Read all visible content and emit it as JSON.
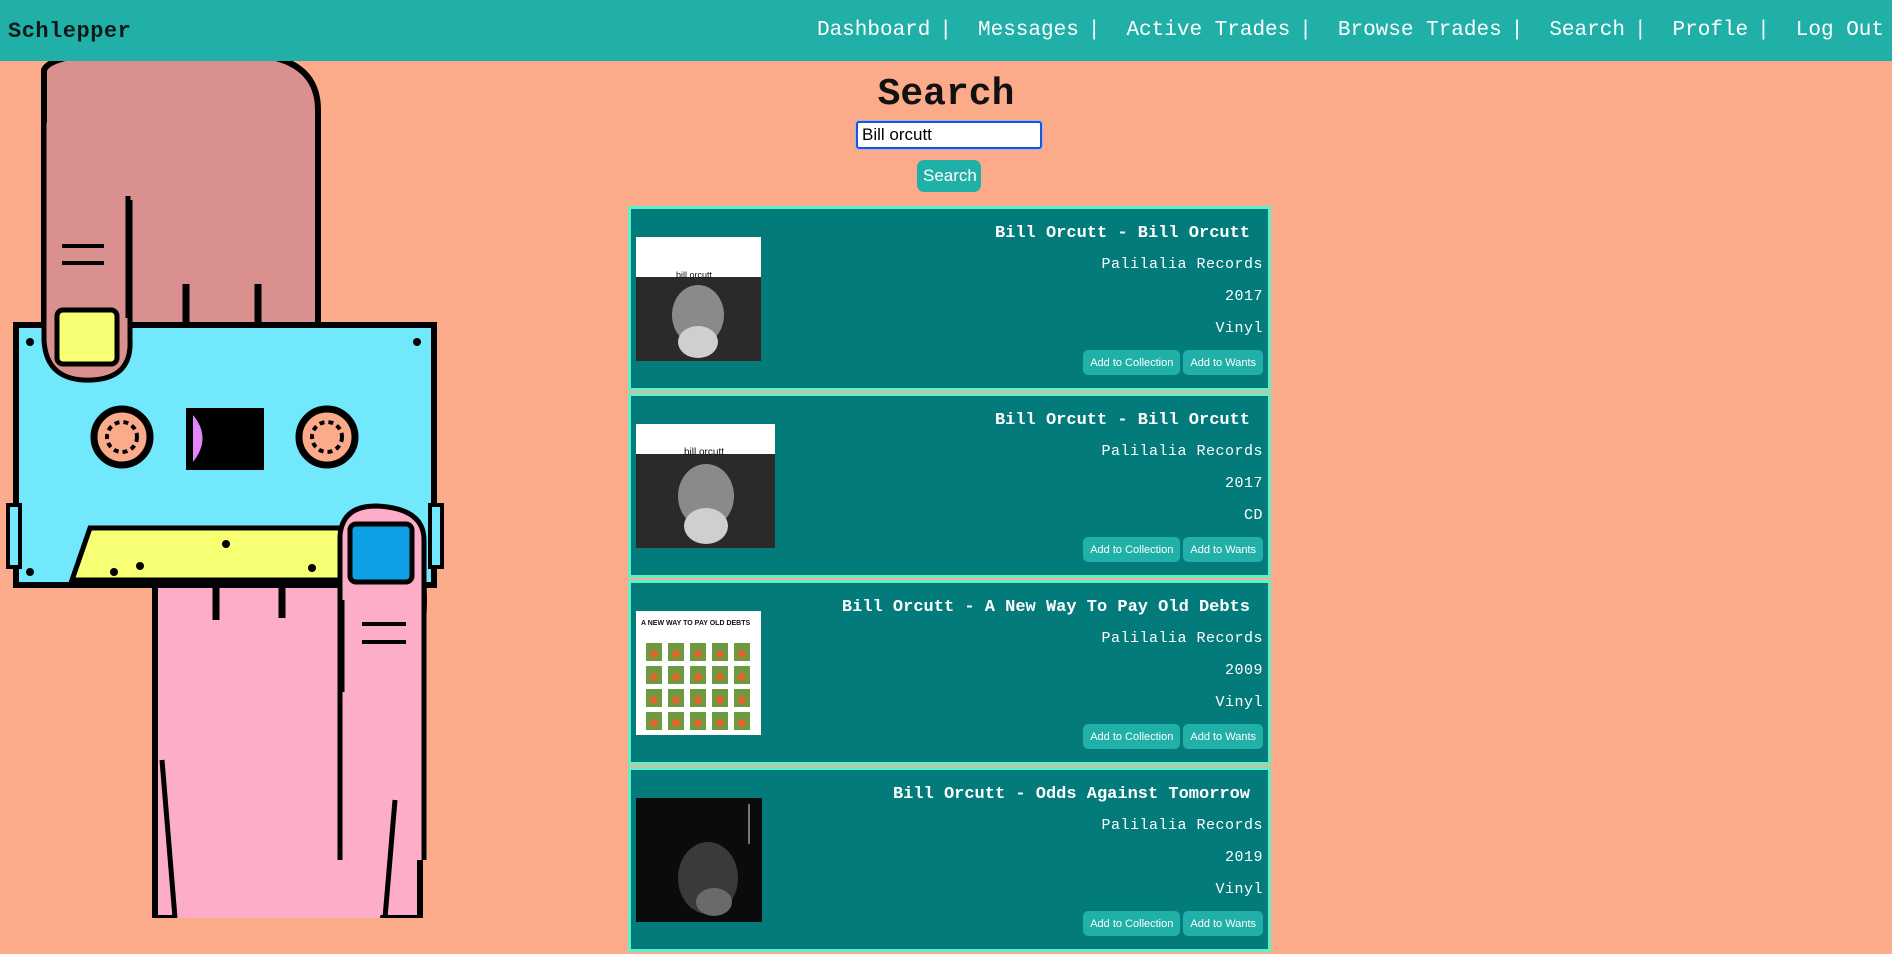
{
  "brand": "Schlepper",
  "nav": [
    {
      "label": "Dashboard"
    },
    {
      "label": "Messages"
    },
    {
      "label": "Active Trades"
    },
    {
      "label": "Browse Trades"
    },
    {
      "label": "Search"
    },
    {
      "label": "Profle"
    },
    {
      "label": "Log Out"
    }
  ],
  "nav_separator": "|",
  "page_title": "Search",
  "search": {
    "value": "Bill orcutt",
    "button_label": "Search"
  },
  "result_buttons": {
    "collection": "Add to Collection",
    "wants": "Add to Wants"
  },
  "thumb_labels": {
    "portrait": "bill orcutt",
    "debts_cover": "A NEW WAY TO PAY OLD DEBTS"
  },
  "colors": {
    "page_bg": "#fbab8a",
    "navbar": "#21b0a8",
    "card_bg": "#047b7b",
    "card_border": "#5ef0c9",
    "button": "#21b0a8"
  },
  "results": [
    {
      "title": "Bill Orcutt - Bill Orcutt",
      "label": "Palilalia Records",
      "year": "2017",
      "format": "Vinyl",
      "thumbnail": "portrait-album-cover"
    },
    {
      "title": "Bill Orcutt - Bill Orcutt",
      "label": "Palilalia Records",
      "year": "2017",
      "format": "CD",
      "thumbnail": "portrait-album-cover"
    },
    {
      "title": "Bill Orcutt - A New Way To Pay Old Debts",
      "label": "Palilalia Records",
      "year": "2009",
      "format": "Vinyl",
      "thumbnail": "stamp-grid-album-cover"
    },
    {
      "title": "Bill Orcutt - Odds Against Tomorrow",
      "label": "Palilalia Records",
      "year": "2019",
      "format": "Vinyl",
      "thumbnail": "dark-portrait-album-cover"
    }
  ]
}
